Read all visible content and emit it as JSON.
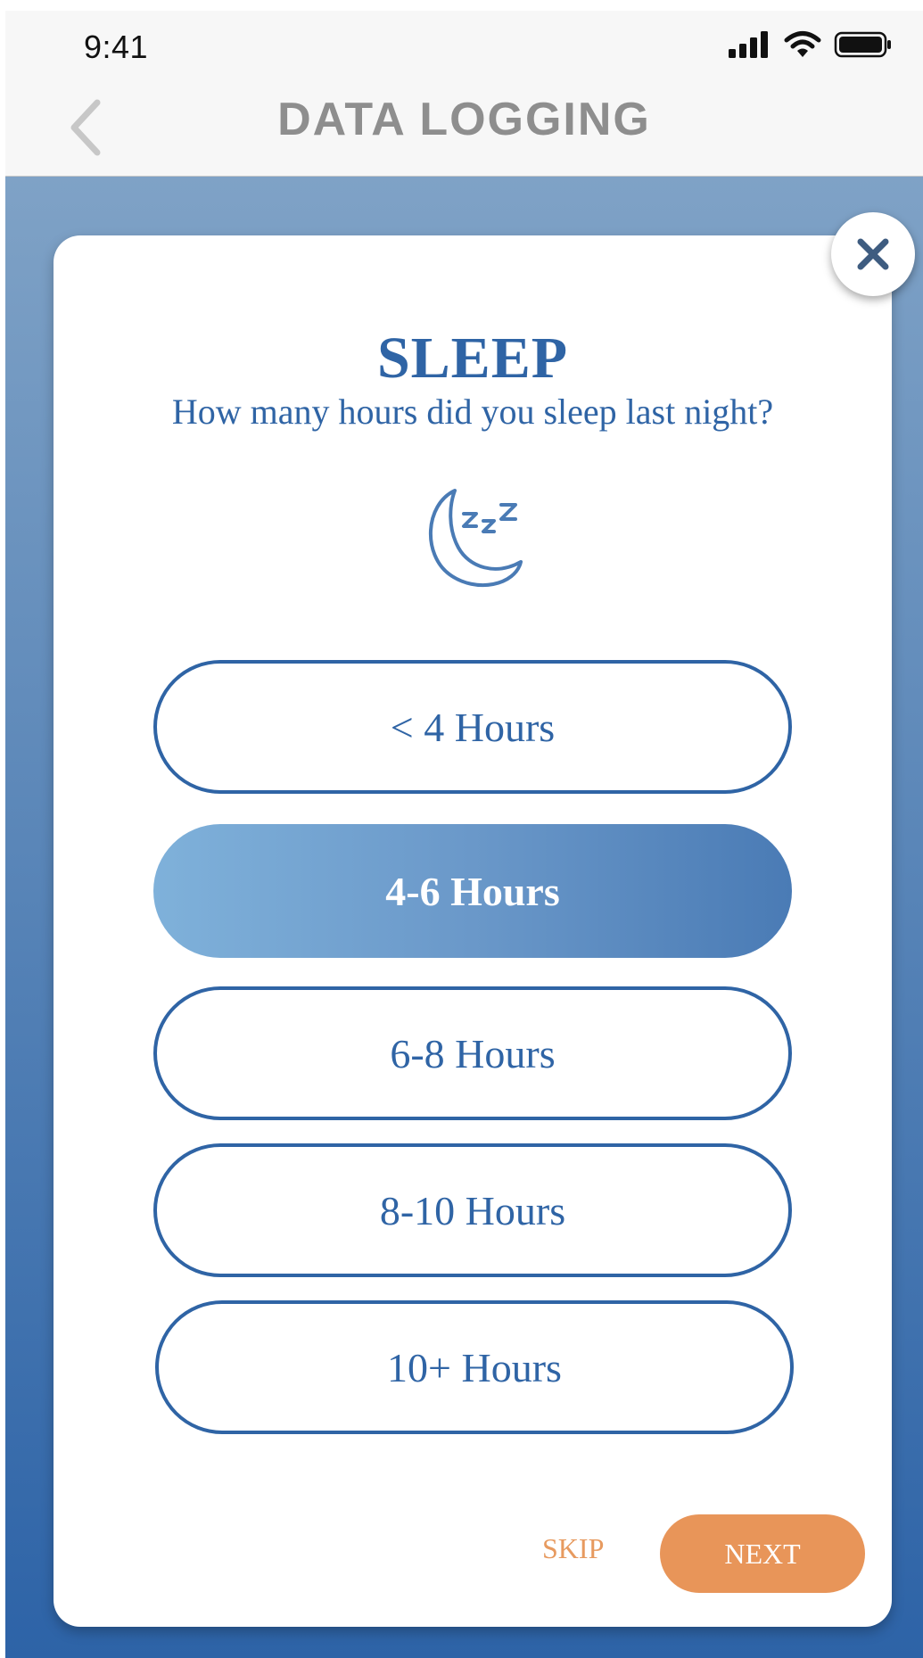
{
  "status_bar": {
    "time": "9:41",
    "icons": [
      "signal-icon",
      "wifi-icon",
      "battery-icon"
    ]
  },
  "nav": {
    "title": "DATA LOGGING",
    "back_icon": "chevron-left-icon"
  },
  "card": {
    "title": "SLEEP",
    "subtitle": "How many hours did you sleep last night?",
    "icon": "moon-zzz-icon",
    "close_icon": "close-icon",
    "options": [
      {
        "label": "< 4 Hours",
        "selected": false
      },
      {
        "label": "4-6 Hours",
        "selected": true
      },
      {
        "label": "6-8 Hours",
        "selected": false
      },
      {
        "label": "8-10 Hours",
        "selected": false
      },
      {
        "label": "10+ Hours",
        "selected": false
      }
    ],
    "skip_label": "SKIP",
    "next_label": "NEXT"
  },
  "colors": {
    "primary": "#2f64a5",
    "accent": "#e89559",
    "nav_title": "#8e8e8e"
  }
}
